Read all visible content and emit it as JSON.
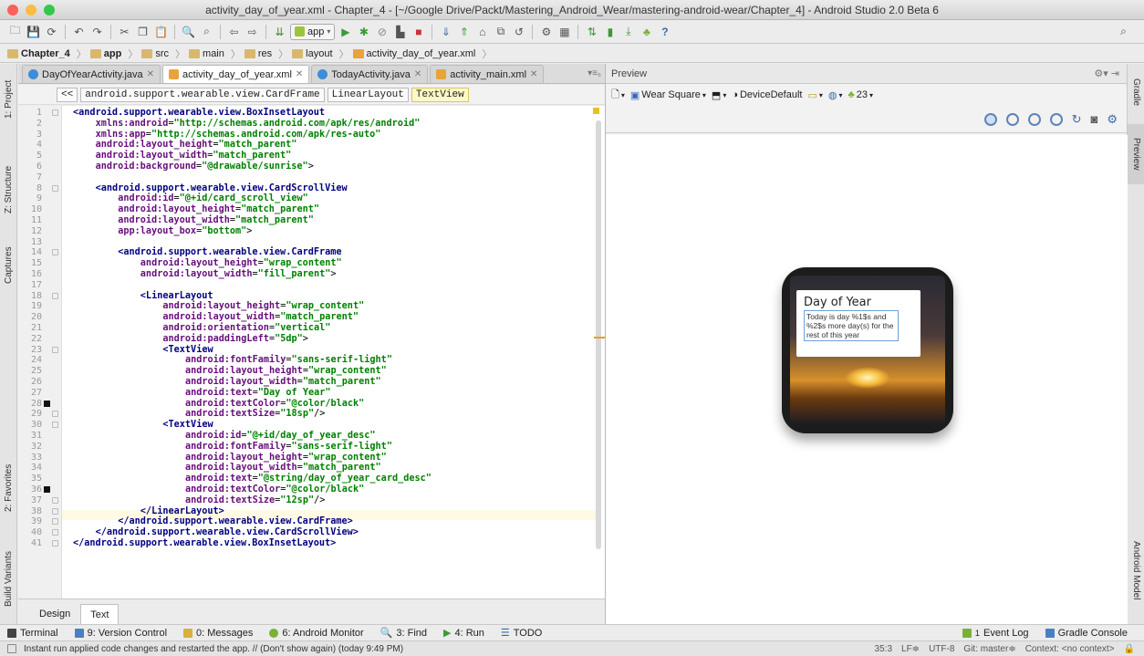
{
  "window": {
    "title": "activity_day_of_year.xml - Chapter_4 - [~/Google Drive/Packt/Mastering_Android_Wear/mastering-android-wear/Chapter_4] - Android Studio 2.0 Beta 6"
  },
  "toolbar": {
    "run_config": "app",
    "help_label": "?"
  },
  "nav": {
    "crumbs": [
      "Chapter_4",
      "app",
      "src",
      "main",
      "res",
      "layout",
      "activity_day_of_year.xml"
    ]
  },
  "side_tabs": {
    "left": [
      "1: Project",
      "Z: Structure",
      "Captures",
      "2: Favorites",
      "Build Variants"
    ],
    "right": [
      "Gradle",
      "Preview",
      "Android Model"
    ]
  },
  "editor_tabs": [
    {
      "label": "DayOfYearActivity.java",
      "active": false
    },
    {
      "label": "activity_day_of_year.xml",
      "active": true
    },
    {
      "label": "TodayActivity.java",
      "active": false
    },
    {
      "label": "activity_main.xml",
      "active": false
    }
  ],
  "tab_overflow": "▾≡₆",
  "component_breadcrumb": {
    "back": "<<",
    "items": [
      "android.support.wearable.view.CardFrame",
      "LinearLayout",
      "TextView"
    ]
  },
  "code_lines": [
    {
      "n": "1",
      "indent": 0,
      "parts": [
        [
          "tag",
          "<android.support.wearable.view.BoxInsetLayout"
        ]
      ]
    },
    {
      "n": "2",
      "indent": 4,
      "parts": [
        [
          "attr",
          "xmlns:android"
        ],
        [
          "p",
          "="
        ],
        [
          "val",
          "\"http://schemas.android.com/apk/res/android\""
        ]
      ]
    },
    {
      "n": "3",
      "indent": 4,
      "parts": [
        [
          "attr",
          "xmlns:app"
        ],
        [
          "p",
          "="
        ],
        [
          "val",
          "\"http://schemas.android.com/apk/res-auto\""
        ]
      ]
    },
    {
      "n": "4",
      "indent": 4,
      "parts": [
        [
          "attr",
          "android:layout_height"
        ],
        [
          "p",
          "="
        ],
        [
          "val",
          "\"match_parent\""
        ]
      ]
    },
    {
      "n": "5",
      "indent": 4,
      "parts": [
        [
          "attr",
          "android:layout_width"
        ],
        [
          "p",
          "="
        ],
        [
          "val",
          "\"match_parent\""
        ]
      ]
    },
    {
      "n": "6",
      "indent": 4,
      "parts": [
        [
          "attr",
          "android:background"
        ],
        [
          "p",
          "="
        ],
        [
          "val",
          "\"@drawable/sunrise\""
        ],
        [
          "p",
          ">"
        ]
      ]
    },
    {
      "n": "7",
      "indent": 0,
      "parts": []
    },
    {
      "n": "8",
      "indent": 4,
      "parts": [
        [
          "tag",
          "<android.support.wearable.view.CardScrollView"
        ]
      ]
    },
    {
      "n": "9",
      "indent": 8,
      "parts": [
        [
          "attr",
          "android:id"
        ],
        [
          "p",
          "="
        ],
        [
          "val",
          "\"@+id/card_scroll_view\""
        ]
      ]
    },
    {
      "n": "10",
      "indent": 8,
      "parts": [
        [
          "attr",
          "android:layout_height"
        ],
        [
          "p",
          "="
        ],
        [
          "val",
          "\"match_parent\""
        ]
      ]
    },
    {
      "n": "11",
      "indent": 8,
      "parts": [
        [
          "attr",
          "android:layout_width"
        ],
        [
          "p",
          "="
        ],
        [
          "val",
          "\"match_parent\""
        ]
      ]
    },
    {
      "n": "12",
      "indent": 8,
      "parts": [
        [
          "attr",
          "app:layout_box"
        ],
        [
          "p",
          "="
        ],
        [
          "val",
          "\"bottom\""
        ],
        [
          "p",
          ">"
        ]
      ]
    },
    {
      "n": "13",
      "indent": 0,
      "parts": []
    },
    {
      "n": "14",
      "indent": 8,
      "parts": [
        [
          "tag",
          "<android.support.wearable.view.CardFrame"
        ]
      ]
    },
    {
      "n": "15",
      "indent": 12,
      "parts": [
        [
          "attr",
          "android:layout_height"
        ],
        [
          "p",
          "="
        ],
        [
          "val",
          "\"wrap_content\""
        ]
      ]
    },
    {
      "n": "16",
      "indent": 12,
      "parts": [
        [
          "attr",
          "android:layout_width"
        ],
        [
          "p",
          "="
        ],
        [
          "val",
          "\"fill_parent\""
        ],
        [
          "p",
          ">"
        ]
      ]
    },
    {
      "n": "17",
      "indent": 0,
      "parts": []
    },
    {
      "n": "18",
      "indent": 12,
      "parts": [
        [
          "tag",
          "<LinearLayout"
        ]
      ]
    },
    {
      "n": "19",
      "indent": 16,
      "parts": [
        [
          "attr",
          "android:layout_height"
        ],
        [
          "p",
          "="
        ],
        [
          "val",
          "\"wrap_content\""
        ]
      ]
    },
    {
      "n": "20",
      "indent": 16,
      "parts": [
        [
          "attr",
          "android:layout_width"
        ],
        [
          "p",
          "="
        ],
        [
          "val",
          "\"match_parent\""
        ]
      ]
    },
    {
      "n": "21",
      "indent": 16,
      "parts": [
        [
          "attr",
          "android:orientation"
        ],
        [
          "p",
          "="
        ],
        [
          "val",
          "\"vertical\""
        ]
      ]
    },
    {
      "n": "22",
      "indent": 16,
      "parts": [
        [
          "attr",
          "android:paddingLeft"
        ],
        [
          "p",
          "="
        ],
        [
          "val",
          "\"5dp\""
        ],
        [
          "p",
          ">"
        ]
      ]
    },
    {
      "n": "23",
      "indent": 16,
      "parts": [
        [
          "tag",
          "<TextView"
        ]
      ]
    },
    {
      "n": "24",
      "indent": 20,
      "parts": [
        [
          "attr",
          "android:fontFamily"
        ],
        [
          "p",
          "="
        ],
        [
          "val",
          "\"sans-serif-light\""
        ]
      ]
    },
    {
      "n": "25",
      "indent": 20,
      "parts": [
        [
          "attr",
          "android:layout_height"
        ],
        [
          "p",
          "="
        ],
        [
          "val",
          "\"wrap_content\""
        ]
      ]
    },
    {
      "n": "26",
      "indent": 20,
      "parts": [
        [
          "attr",
          "android:layout_width"
        ],
        [
          "p",
          "="
        ],
        [
          "val",
          "\"match_parent\""
        ]
      ]
    },
    {
      "n": "27",
      "indent": 20,
      "parts": [
        [
          "attr",
          "android:text"
        ],
        [
          "p",
          "="
        ],
        [
          "val",
          "\"Day of Year\""
        ]
      ]
    },
    {
      "n": "28",
      "indent": 20,
      "parts": [
        [
          "attr",
          "android:textColor"
        ],
        [
          "p",
          "="
        ],
        [
          "val",
          "\"@color/black\""
        ]
      ]
    },
    {
      "n": "29",
      "indent": 20,
      "parts": [
        [
          "attr",
          "android:textSize"
        ],
        [
          "p",
          "="
        ],
        [
          "val",
          "\"18sp\""
        ],
        [
          "p",
          "/>"
        ]
      ]
    },
    {
      "n": "30",
      "indent": 16,
      "parts": [
        [
          "tag",
          "<TextView"
        ]
      ]
    },
    {
      "n": "31",
      "indent": 20,
      "parts": [
        [
          "attr",
          "android:id"
        ],
        [
          "p",
          "="
        ],
        [
          "val",
          "\"@+id/day_of_year_desc\""
        ]
      ]
    },
    {
      "n": "32",
      "indent": 20,
      "parts": [
        [
          "attr",
          "android:fontFamily"
        ],
        [
          "p",
          "="
        ],
        [
          "val",
          "\"sans-serif-light\""
        ]
      ]
    },
    {
      "n": "33",
      "indent": 20,
      "parts": [
        [
          "attr",
          "android:layout_height"
        ],
        [
          "p",
          "="
        ],
        [
          "val",
          "\"wrap_content\""
        ]
      ]
    },
    {
      "n": "34",
      "indent": 20,
      "parts": [
        [
          "attr",
          "android:layout_width"
        ],
        [
          "p",
          "="
        ],
        [
          "val",
          "\"match_parent\""
        ]
      ]
    },
    {
      "n": "35",
      "indent": 20,
      "parts": [
        [
          "attr",
          "android:text"
        ],
        [
          "p",
          "="
        ],
        [
          "val",
          "\"@string/day_of_year_card_desc\""
        ]
      ]
    },
    {
      "n": "36",
      "indent": 20,
      "parts": [
        [
          "attr",
          "android:textColor"
        ],
        [
          "p",
          "="
        ],
        [
          "val",
          "\"@color/black\""
        ]
      ]
    },
    {
      "n": "37",
      "indent": 20,
      "parts": [
        [
          "attr",
          "android:textSize"
        ],
        [
          "p",
          "="
        ],
        [
          "val",
          "\"12sp\""
        ],
        [
          "p",
          "/>"
        ]
      ]
    },
    {
      "n": "38",
      "indent": 12,
      "parts": [
        [
          "tag",
          "</LinearLayout>"
        ]
      ]
    },
    {
      "n": "39",
      "indent": 8,
      "parts": [
        [
          "tag",
          "</android.support.wearable.view.CardFrame>"
        ]
      ]
    },
    {
      "n": "40",
      "indent": 4,
      "parts": [
        [
          "tag",
          "</android.support.wearable.view.CardScrollView>"
        ]
      ]
    },
    {
      "n": "41",
      "indent": 0,
      "parts": [
        [
          "tag",
          "</android.support.wearable.view.BoxInsetLayout>"
        ]
      ]
    }
  ],
  "editor_modes": {
    "design": "Design",
    "text": "Text"
  },
  "preview": {
    "title": "Preview",
    "device": "Wear Square",
    "theme": "DeviceDefault",
    "api": "23",
    "card_title": "Day of Year",
    "card_desc": "Today is day %1$s and %2$s more day(s) for the rest of this year"
  },
  "tool_windows": {
    "terminal": "Terminal",
    "version_control": "9: Version Control",
    "messages": "0: Messages",
    "android_monitor": "6: Android Monitor",
    "find": "3: Find",
    "run": "4: Run",
    "todo": "TODO",
    "event_log": "Event Log",
    "event_log_count": "1",
    "gradle_console": "Gradle Console"
  },
  "status": {
    "message": "Instant run applied code changes and restarted the app. // (Don't show again) (today 9:49 PM)",
    "position": "35:3",
    "line_sep": "LF≑",
    "encoding": "UTF-8",
    "git": "Git: master≑",
    "context": "Context: <no context>"
  },
  "colors": {
    "tag": "#000080",
    "attr": "#660e7a",
    "value": "#008000",
    "close": "#fc605b",
    "minimize": "#fdbc40",
    "zoom": "#34c84a"
  }
}
